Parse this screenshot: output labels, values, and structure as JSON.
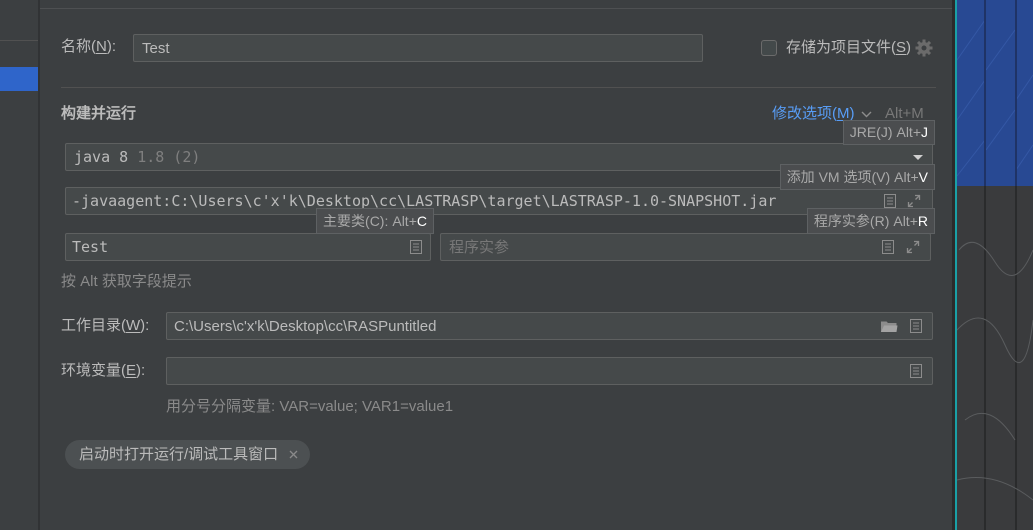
{
  "colors": {
    "panel_bg": "#3c3f41",
    "field_bg": "#45494a",
    "field_border": "#5e6060",
    "text": "#bbbbbb",
    "hint_text": "#8a8a8a",
    "link": "#589df6",
    "selection": "#2f65ca",
    "tooltip_bg": "#4b4d4f"
  },
  "name_row": {
    "label": "名称(N):",
    "value": "Test",
    "store_checkbox": {
      "label": "存储为项目文件(S)",
      "checked": false,
      "icon": "gear-icon"
    }
  },
  "build_run": {
    "title": "构建并运行",
    "modify_options": {
      "label": "修改选项(M)",
      "shortcut": "Alt+M",
      "icon": "chevron-down-icon"
    },
    "jre": {
      "name": "java 8",
      "version": "1.8 (2)",
      "icon": "dropdown-arrow-icon"
    },
    "vm_options": {
      "value": "-javaagent:C:\\Users\\c'x'k\\Desktop\\cc\\LASTRASP\\target\\LASTRASP-1.0-SNAPSHOT.jar",
      "icons": [
        "expand-text-icon",
        "expand-field-icon"
      ]
    },
    "main_class": {
      "value": "Test",
      "icons": [
        "expand-text-icon"
      ]
    },
    "program_args": {
      "placeholder": "程序实参",
      "icons": [
        "expand-text-icon",
        "expand-field-icon"
      ]
    }
  },
  "field_hints": [
    {
      "label": "JRE(J)",
      "shortcut": "Alt+J"
    },
    {
      "label": "添加 VM 选项(V)",
      "shortcut": "Alt+V"
    },
    {
      "label": "主要类(C):",
      "shortcut": "Alt+C"
    },
    {
      "label": "程序实参(R)",
      "shortcut": "Alt+R"
    }
  ],
  "alt_hint": "按 Alt 获取字段提示",
  "working_dir": {
    "label": "工作目录(W):",
    "value": "C:\\Users\\c'x'k\\Desktop\\cc\\RASPuntitled",
    "icons": [
      "folder-icon",
      "expand-text-icon"
    ]
  },
  "env_vars": {
    "label": "环境变量(E):",
    "value": "",
    "hint": "用分号分隔变量: VAR=value; VAR1=value1",
    "icons": [
      "expand-text-icon"
    ]
  },
  "option_chips": [
    {
      "label": "启动时打开运行/调试工具窗口",
      "icon": "close-icon"
    }
  ]
}
